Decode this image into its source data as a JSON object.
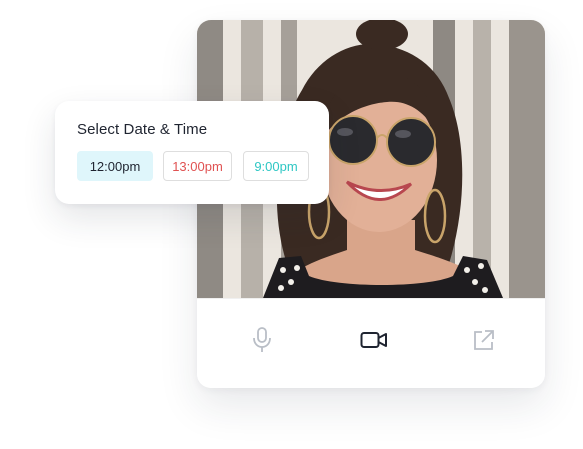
{
  "schedule": {
    "title": "Select Date & Time",
    "slots": [
      {
        "label": "12:00pm",
        "state": "selected",
        "color": "#1f2430"
      },
      {
        "label": "13:00pm",
        "state": "unavailable",
        "color": "#e05252"
      },
      {
        "label": "9:00pm",
        "state": "available",
        "color": "#2ec7c4"
      }
    ]
  },
  "video_call": {
    "controls": [
      {
        "name": "microphone",
        "icon": "microphone-icon",
        "active": false
      },
      {
        "name": "camera",
        "icon": "video-camera-icon",
        "active": true
      },
      {
        "name": "share",
        "icon": "external-share-icon",
        "active": false
      }
    ]
  }
}
